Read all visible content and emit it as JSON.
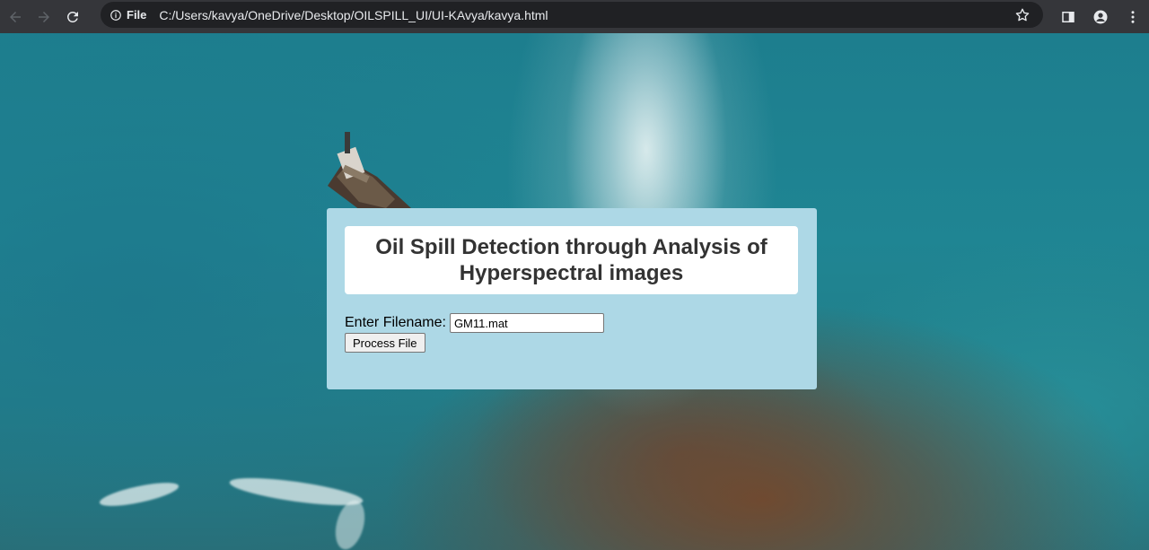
{
  "browser": {
    "chip_label": "File",
    "url": "C:/Users/kavya/OneDrive/Desktop/OILSPILL_UI/UI-KAvya/kavya.html",
    "icons": [
      "back-arrow-icon",
      "forward-arrow-icon",
      "reload-icon",
      "info-icon",
      "star-icon",
      "side-panel-icon",
      "profile-icon",
      "menu-dots-icon"
    ]
  },
  "page": {
    "title": "Oil Spill Detection through Analysis of Hyperspectral images",
    "filename_label": "Enter Filename:",
    "filename_value": "GM11.mat",
    "process_button": "Process File"
  },
  "colors": {
    "card_bg": "#add8e6",
    "title_bg": "#ffffff",
    "title_text": "#333333",
    "browser_bar": "#35363a"
  }
}
